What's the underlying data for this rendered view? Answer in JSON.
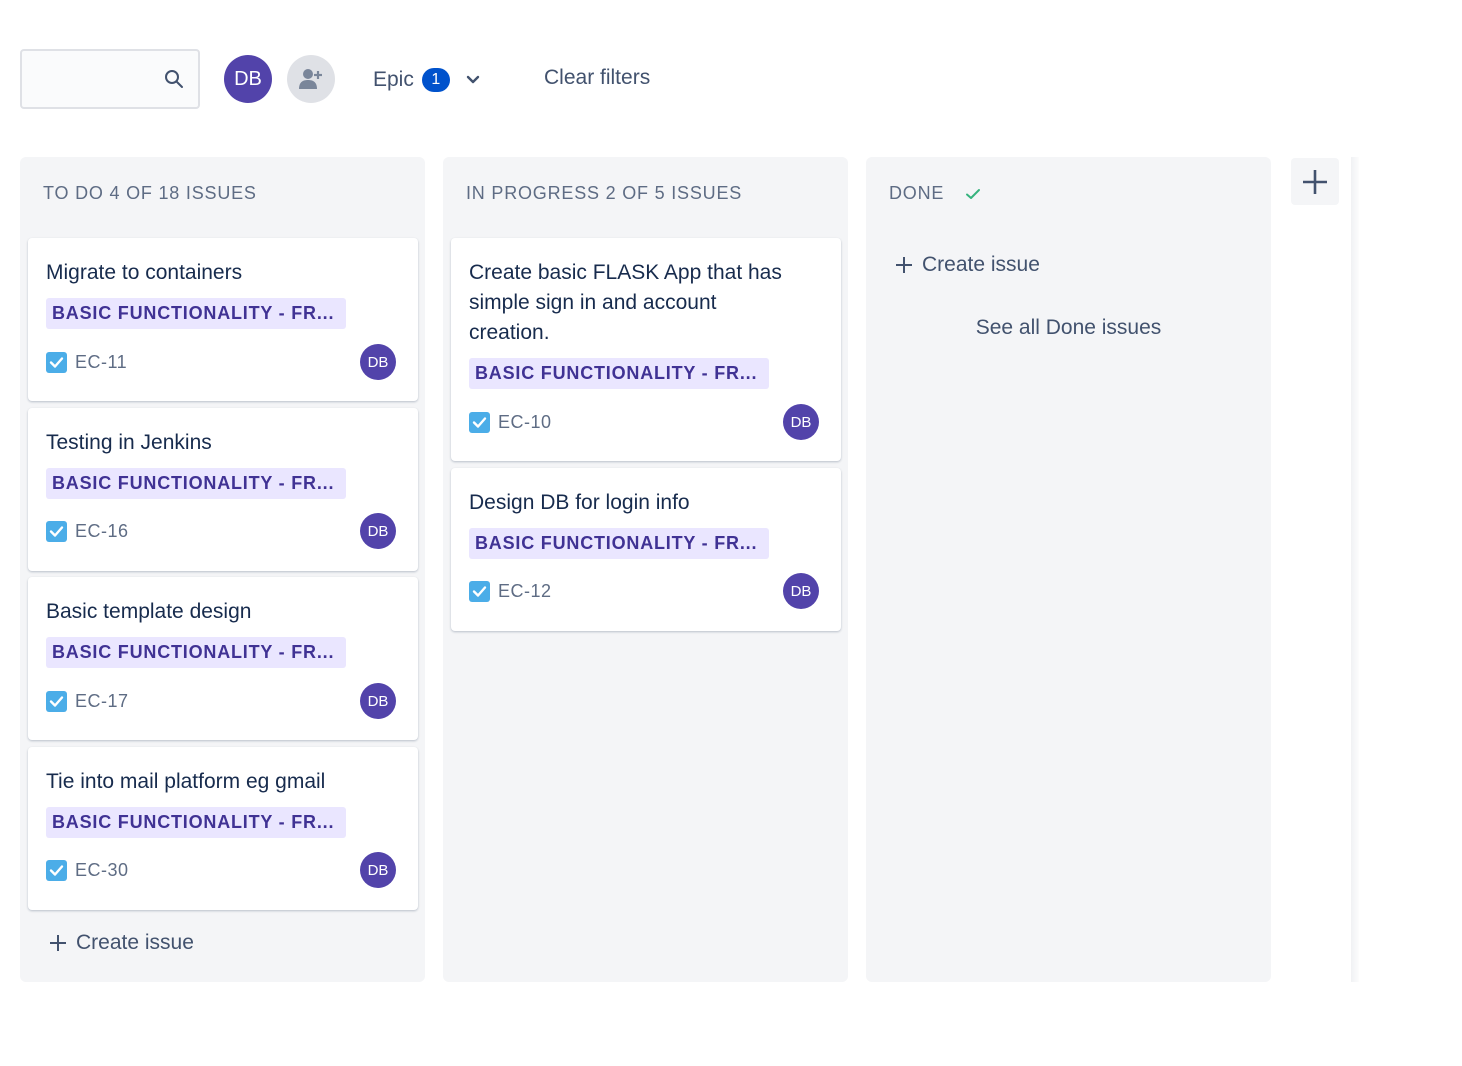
{
  "toolbar": {
    "search": {
      "value": "",
      "placeholder": "",
      "icon": "search-icon"
    },
    "user_avatar": "DB",
    "add_people_icon": "add-user-icon",
    "epic_filter": {
      "label": "Epic",
      "count": "1"
    },
    "clear_filters": "Clear filters"
  },
  "columns": {
    "todo": {
      "header": "TO DO 4 OF 18 ISSUES",
      "cards": [
        {
          "title": "Migrate to containers",
          "epic": "BASIC FUNCTIONALITY - FR...",
          "key": "EC-11",
          "assignee": "DB"
        },
        {
          "title": "Testing in Jenkins",
          "epic": "BASIC FUNCTIONALITY - FR...",
          "key": "EC-16",
          "assignee": "DB"
        },
        {
          "title": "Basic template design",
          "epic": "BASIC FUNCTIONALITY - FR...",
          "key": "EC-17",
          "assignee": "DB"
        },
        {
          "title": "Tie into mail platform eg gmail",
          "epic": "BASIC FUNCTIONALITY - FR...",
          "key": "EC-30",
          "assignee": "DB"
        }
      ],
      "create": "Create issue"
    },
    "progress": {
      "header": "IN PROGRESS 2 OF 5 ISSUES",
      "cards": [
        {
          "title": "Create basic FLASK App that has simple sign in and account creation.",
          "epic": "BASIC FUNCTIONALITY - FR...",
          "key": "EC-10",
          "assignee": "DB"
        },
        {
          "title": "Design DB for login info",
          "epic": "BASIC FUNCTIONALITY - FR...",
          "key": "EC-12",
          "assignee": "DB"
        }
      ]
    },
    "done": {
      "header": "DONE",
      "create": "Create issue",
      "see_all": "See all Done issues"
    }
  },
  "colors": {
    "avatar": "#5243aa",
    "epic_bg": "#eae6ff",
    "epic_text": "#403294",
    "column_bg": "#f4f5f7",
    "badge": "#0052cc",
    "task_icon": "#4bade8",
    "done_check": "#36b37e"
  }
}
